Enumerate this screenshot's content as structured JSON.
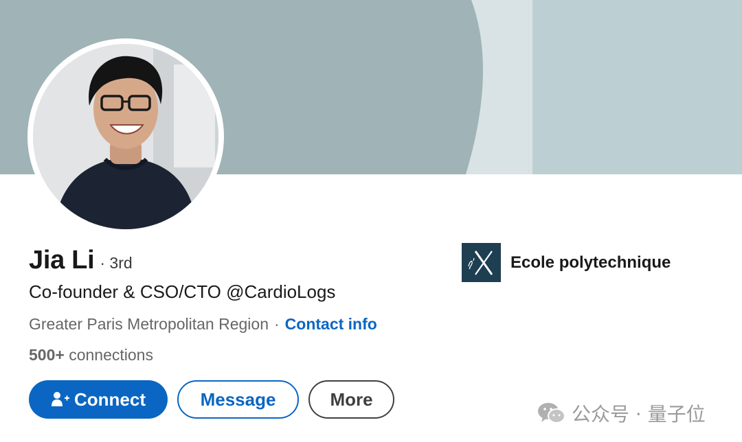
{
  "profile": {
    "name": "Jia Li",
    "degree": "· 3rd",
    "headline": "Co-founder & CSO/CTO @CardioLogs",
    "location": "Greater Paris Metropolitan Region",
    "location_separator": "·",
    "contact_info_label": "Contact info",
    "connections_count": "500+",
    "connections_label": "connections"
  },
  "actions": {
    "connect_label": "Connect",
    "connect_icon": "add-person-icon",
    "message_label": "Message",
    "more_label": "More"
  },
  "education": {
    "school_name": "Ecole polytechnique",
    "logo_icon": "ecole-polytechnique-logo"
  },
  "watermark": {
    "icon": "wechat-icon",
    "text": "公众号 · 量子位"
  },
  "colors": {
    "accent": "#0a66c2",
    "banner": "#a0b3b7",
    "banner_light": "#d9e3e5",
    "school_logo_bg": "#1e3e52",
    "secondary_text": "#666666"
  }
}
